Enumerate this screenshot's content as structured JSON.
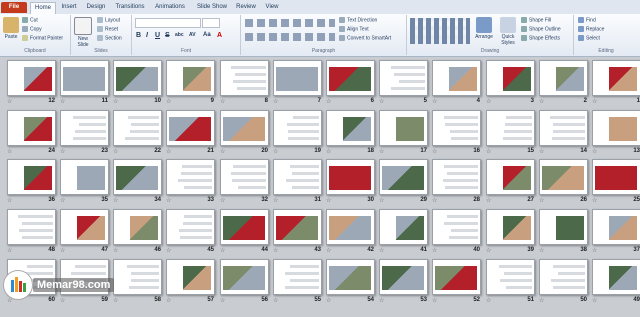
{
  "tabs": [
    "File",
    "Home",
    "Insert",
    "Design",
    "Transitions",
    "Animations",
    "Slide Show",
    "Review",
    "View"
  ],
  "ribbon": {
    "clipboard": {
      "paste": "Paste",
      "cut": "Cut",
      "copy": "Copy",
      "format_painter": "Format Painter",
      "label": "Clipboard"
    },
    "slides": {
      "new_slide": "New Slide",
      "layout": "Layout",
      "reset": "Reset",
      "section": "Section",
      "label": "Slides"
    },
    "font": {
      "bold": "B",
      "italic": "I",
      "underline": "U",
      "strike": "S",
      "shadow": "abc",
      "spacing": "AV",
      "case": "Aa",
      "color": "A",
      "label": "Font"
    },
    "paragraph": {
      "text_direction": "Text Direction",
      "align_text": "Align Text",
      "smartart": "Convert to SmartArt",
      "label": "Paragraph"
    },
    "drawing": {
      "arrange": "Arrange",
      "quick_styles": "Quick Styles",
      "shape_fill": "Shape Fill",
      "shape_outline": "Shape Outline",
      "shape_effects": "Shape Effects",
      "label": "Drawing"
    },
    "editing": {
      "find": "Find",
      "replace": "Replace",
      "select": "Select",
      "label": "Editing"
    }
  },
  "slides": {
    "row1": [
      "12",
      "11",
      "10",
      "9",
      "8",
      "7",
      "6",
      "5",
      "4",
      "3",
      "2",
      "1"
    ],
    "row2": [
      "24",
      "23",
      "22",
      "21",
      "20",
      "19",
      "18",
      "17",
      "16",
      "15",
      "14",
      "13"
    ],
    "row3": [
      "36",
      "35",
      "34",
      "33",
      "32",
      "31",
      "30",
      "29",
      "28",
      "27",
      "26",
      "25"
    ],
    "row4": [
      "48",
      "47",
      "46",
      "45",
      "44",
      "43",
      "42",
      "41",
      "40",
      "39",
      "38",
      "37"
    ],
    "row5": [
      "60",
      "59",
      "58",
      "57",
      "56",
      "55",
      "54",
      "53",
      "52",
      "51",
      "50",
      "49"
    ]
  },
  "watermark": "Memar98.com",
  "colors": {
    "accent_file": "#c33b1c",
    "ribbon_bg": "#e4eaf3",
    "sorter_bg": "#c9ccd1",
    "photo_red": "#b3202a"
  }
}
